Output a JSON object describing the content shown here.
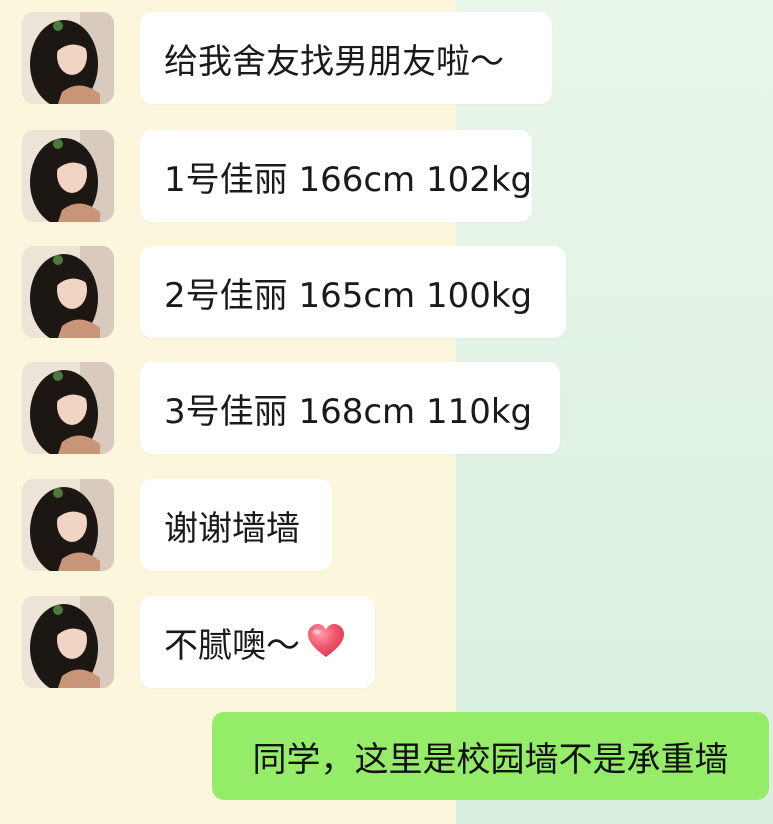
{
  "chat": {
    "messages": [
      {
        "sender": "other",
        "text": "给我舍友找男朋友啦～"
      },
      {
        "sender": "other",
        "text": "1号佳丽 166cm 102kg"
      },
      {
        "sender": "other",
        "text": "2号佳丽 165cm 100kg"
      },
      {
        "sender": "other",
        "text": "3号佳丽 168cm 110kg"
      },
      {
        "sender": "other",
        "text": "谢谢墙墙"
      },
      {
        "sender": "other",
        "text": "不腻噢～",
        "emoji": "heart-icon"
      }
    ],
    "reply": {
      "sender": "self",
      "text": "同学，这里是校园墙不是承重墙"
    }
  },
  "colors": {
    "left_background": "#fbf6dc",
    "right_background": "#e3f4e4",
    "incoming_bubble": "#ffffff",
    "outgoing_bubble": "#95ec69",
    "heart": "#f0566b"
  }
}
